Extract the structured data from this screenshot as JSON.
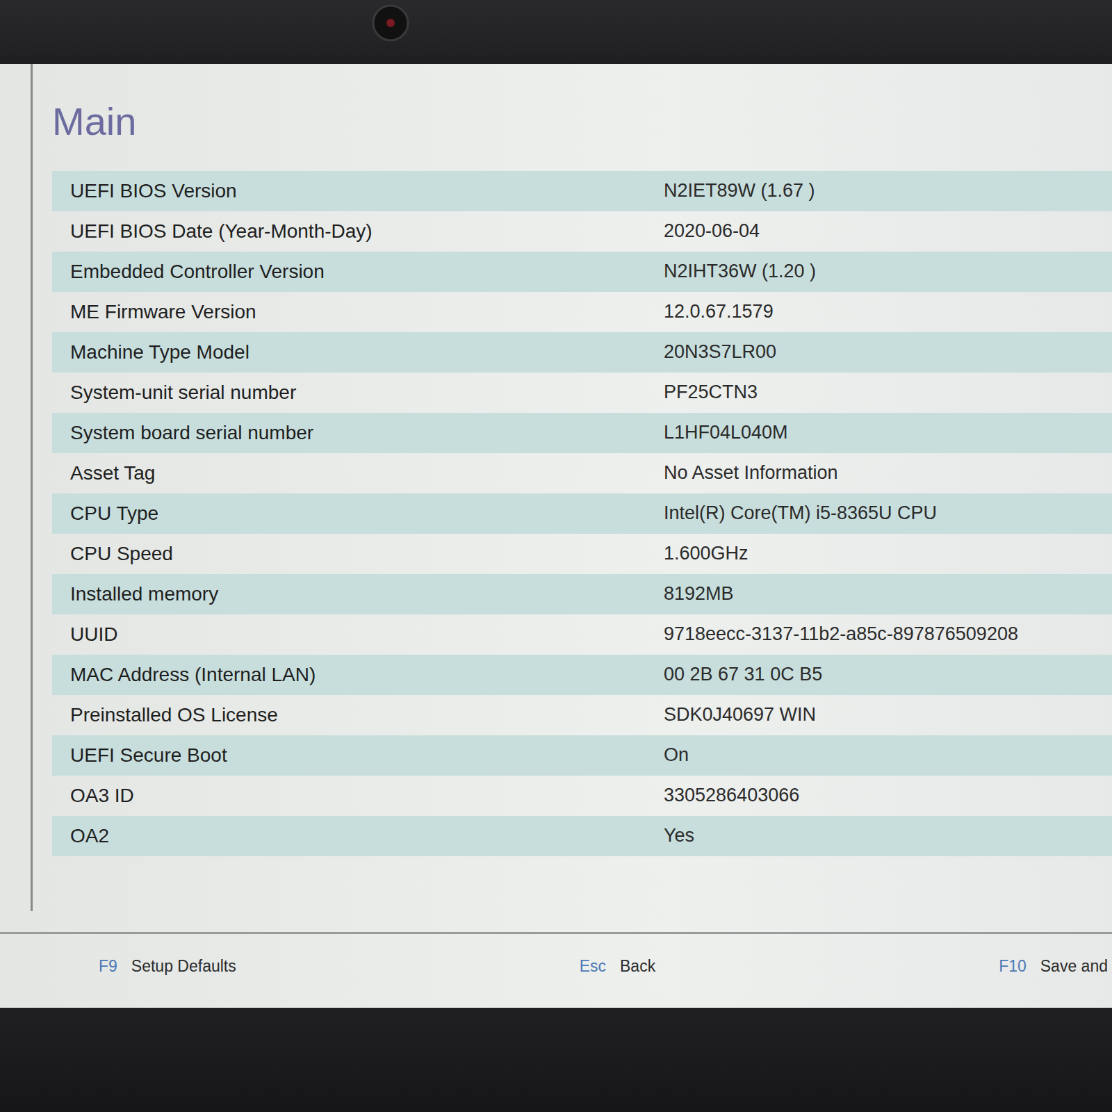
{
  "screen": {
    "title": "Main"
  },
  "rows": [
    {
      "label": "UEFI BIOS Version",
      "value": "N2IET89W (1.67 )"
    },
    {
      "label": "UEFI BIOS Date (Year-Month-Day)",
      "value": "2020-06-04"
    },
    {
      "label": "Embedded Controller Version",
      "value": "N2IHT36W (1.20 )"
    },
    {
      "label": "ME Firmware Version",
      "value": "12.0.67.1579"
    },
    {
      "label": "Machine Type Model",
      "value": "20N3S7LR00"
    },
    {
      "label": "System-unit serial number",
      "value": "PF25CTN3"
    },
    {
      "label": "System board serial number",
      "value": "L1HF04L040M"
    },
    {
      "label": "Asset Tag",
      "value": "No Asset Information"
    },
    {
      "label": "CPU Type",
      "value": "Intel(R) Core(TM) i5-8365U CPU"
    },
    {
      "label": "CPU Speed",
      "value": "1.600GHz"
    },
    {
      "label": "Installed memory",
      "value": "8192MB"
    },
    {
      "label": "UUID",
      "value": "9718eecc-3137-11b2-a85c-897876509208"
    },
    {
      "label": "MAC Address (Internal LAN)",
      "value": "00 2B 67 31 0C B5"
    },
    {
      "label": "Preinstalled OS License",
      "value": "SDK0J40697 WIN"
    },
    {
      "label": "UEFI Secure Boot",
      "value": "On"
    },
    {
      "label": "OA3 ID",
      "value": "3305286403066"
    },
    {
      "label": "OA2",
      "value": "Yes"
    }
  ],
  "footer": [
    {
      "key": "F9",
      "label": "Setup Defaults"
    },
    {
      "key": "Esc",
      "label": "Back"
    },
    {
      "key": "F10",
      "label": "Save and"
    }
  ]
}
